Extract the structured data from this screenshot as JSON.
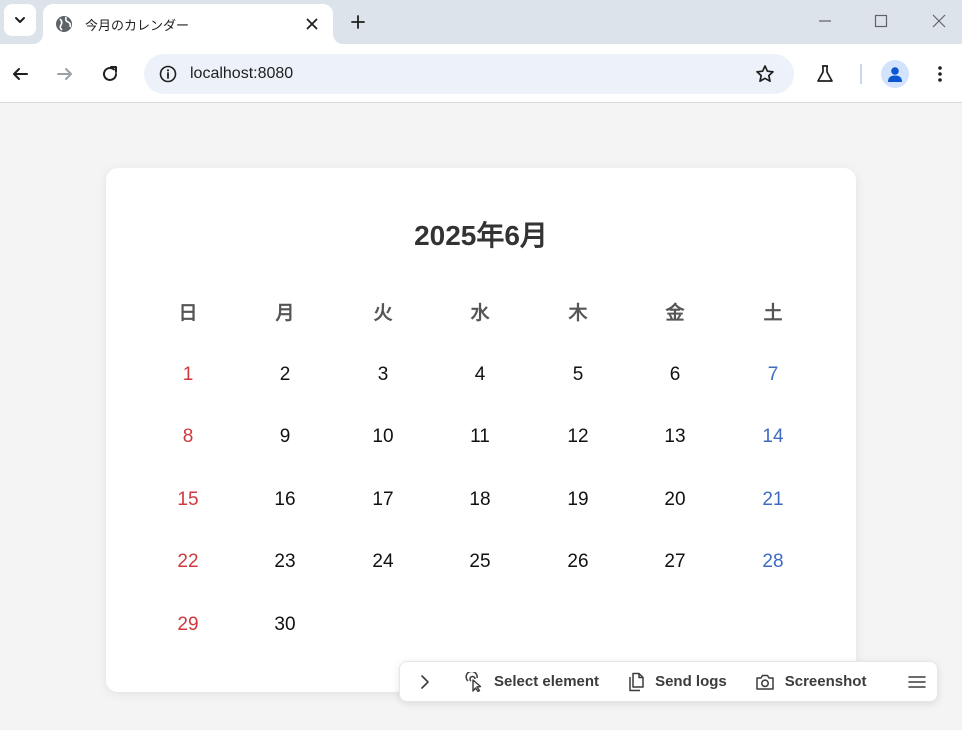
{
  "browser": {
    "tab_title": "今月のカレンダー",
    "url": "localhost:8080",
    "icons": {
      "tab_search": "chevron-down-icon",
      "favicon": "globe-icon",
      "tab_close": "close-icon",
      "new_tab": "plus-icon",
      "back": "arrow-left-icon",
      "forward": "arrow-right-icon",
      "reload": "reload-icon",
      "site_info": "info-icon",
      "bookmark": "star-icon",
      "labs": "flask-icon",
      "profile": "person-icon",
      "menu": "kebab-menu-icon"
    }
  },
  "calendar": {
    "title": "2025年6月",
    "weekdays": [
      "日",
      "月",
      "火",
      "水",
      "木",
      "金",
      "土"
    ],
    "colors": {
      "sunday": "#d0393e",
      "saturday": "#3f6bbf",
      "weekday": "#111111"
    },
    "weeks": [
      [
        "1",
        "2",
        "3",
        "4",
        "5",
        "6",
        "7"
      ],
      [
        "8",
        "9",
        "10",
        "11",
        "12",
        "13",
        "14"
      ],
      [
        "15",
        "16",
        "17",
        "18",
        "19",
        "20",
        "21"
      ],
      [
        "22",
        "23",
        "24",
        "25",
        "26",
        "27",
        "28"
      ],
      [
        "29",
        "30",
        "",
        "",
        "",
        "",
        ""
      ]
    ]
  },
  "devbar": {
    "select_element": "Select element",
    "send_logs": "Send logs",
    "screenshot": "Screenshot",
    "icons": {
      "expand": "chevron-right-icon",
      "select": "pointer-click-icon",
      "logs": "copy-icon",
      "screenshot": "camera-icon",
      "menu": "hamburger-menu-icon"
    }
  }
}
